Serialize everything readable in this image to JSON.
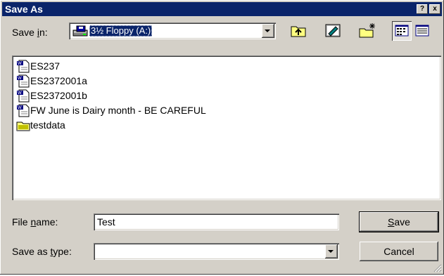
{
  "window": {
    "title": "Save As"
  },
  "title_buttons": {
    "help": "?",
    "close": "x"
  },
  "save_in": {
    "label_prefix": "Save ",
    "label_mnemonic": "i",
    "label_suffix": "n:",
    "selected": "3½ Floppy (A:)"
  },
  "toolbar": [
    {
      "name": "up-one-level-button",
      "icon": "folder-up-icon"
    },
    {
      "name": "desktop-button",
      "icon": "desktop-icon"
    },
    {
      "name": "new-folder-button",
      "icon": "new-folder-icon"
    },
    {
      "name": "list-view-button",
      "icon": "list-view-icon",
      "pressed": true
    },
    {
      "name": "details-view-button",
      "icon": "details-view-icon"
    }
  ],
  "files": [
    {
      "name": "ES237",
      "icon": "word-document-icon"
    },
    {
      "name": "ES2372001a",
      "icon": "word-document-icon"
    },
    {
      "name": "ES2372001b",
      "icon": "word-document-icon"
    },
    {
      "name": "FW June is Dairy month - BE CAREFUL",
      "icon": "word-document-icon"
    },
    {
      "name": "testdata",
      "icon": "folder-icon"
    }
  ],
  "file_name": {
    "label_prefix": "File ",
    "label_mnemonic": "n",
    "label_suffix": "ame:",
    "value": "Test"
  },
  "save_as_type": {
    "label_prefix": "Save as ",
    "label_mnemonic": "t",
    "label_suffix": "ype:",
    "value": ""
  },
  "buttons": {
    "save_mnemonic": "S",
    "save_rest": "ave",
    "cancel": "Cancel"
  },
  "colors": {
    "titlebar": "#0a246a",
    "face": "#d4d0c8",
    "selection": "#0a246a"
  }
}
